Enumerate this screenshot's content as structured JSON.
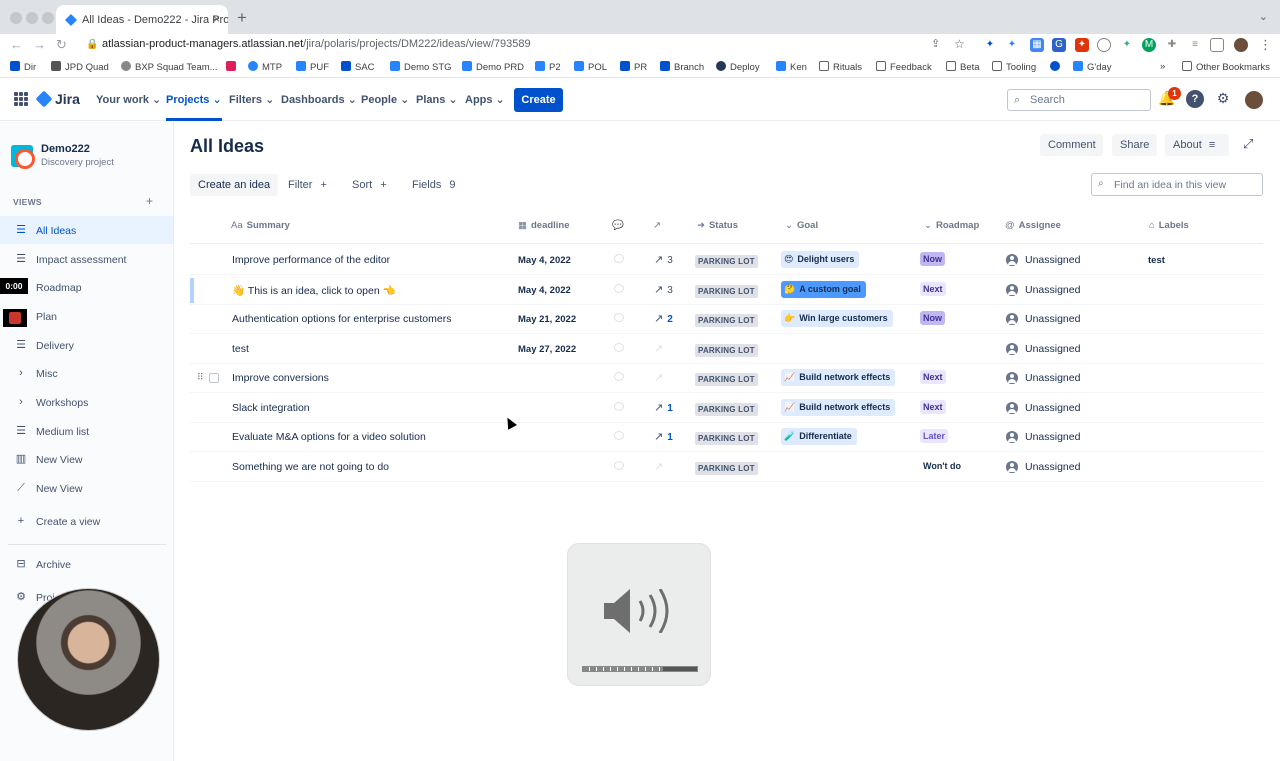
{
  "browser": {
    "tab_title": "All Ideas - Demo222 - Jira Pro…",
    "tab_close": "×",
    "new_tab": "+",
    "url_host": "atlassian-product-managers.atlassian.net",
    "url_path": "/jira/polaris/projects/DM222/ideas/view/793589",
    "bookmarks": [
      "Dir",
      "JPD Quad",
      "BXP Squad Team...",
      "MTP",
      "PUF",
      "SAC",
      "Demo STG",
      "Demo PRD",
      "P2",
      "POL",
      "PR",
      "Branch",
      "Deploy",
      "Ken",
      "Rituals",
      "Feedback",
      "Beta",
      "Tooling",
      "G'day"
    ],
    "bookmarks_overflow": "»",
    "other_bookmarks": "Other Bookmarks"
  },
  "topnav": {
    "logo": "Jira",
    "items": [
      "Your work",
      "Projects",
      "Filters",
      "Dashboards",
      "People",
      "Plans",
      "Apps"
    ],
    "create": "Create",
    "search_placeholder": "Search",
    "notification_count": "1"
  },
  "sidebar": {
    "project_name": "Demo222",
    "project_type": "Discovery project",
    "views_label": "VIEWS",
    "items": [
      "All Ideas",
      "Impact assessment",
      "Roadmap",
      "Plan",
      "Delivery",
      "Misc",
      "Workshops",
      "Medium list",
      "New View",
      "New View",
      "Create a view",
      "Archive",
      "Proj…"
    ],
    "timer": "0:00"
  },
  "main": {
    "title": "All Ideas",
    "header_buttons": [
      "Comment",
      "Share",
      "About"
    ],
    "toolbar": {
      "create": "Create an idea",
      "filter": "Filter",
      "sort": "Sort",
      "fields": "Fields",
      "fields_count": "9",
      "find_placeholder": "Find an idea in this view"
    },
    "columns": [
      "Summary",
      "deadline",
      "Status",
      "Goal",
      "Roadmap",
      "Assignee",
      "Labels"
    ],
    "rows": [
      {
        "summary": "Improve performance of the editor",
        "deadline": "May 4, 2022",
        "trend": "3",
        "status": "PARKING LOT",
        "goal_emoji": "😍",
        "goal": "Delight users",
        "roadmap": "Now",
        "assignee": "Unassigned",
        "labels": "test"
      },
      {
        "summary": "👋 This is an idea, click to open 👈",
        "deadline": "May 4, 2022",
        "trend": "3",
        "status": "PARKING LOT",
        "goal_emoji": "🤔",
        "goal": "A custom goal",
        "roadmap": "Next",
        "assignee": "Unassigned",
        "labels": ""
      },
      {
        "summary": "Authentication options for enterprise customers",
        "deadline": "May 21, 2022",
        "trend": "2",
        "status": "PARKING LOT",
        "goal_emoji": "👉",
        "goal": "Win large customers",
        "roadmap": "Now",
        "assignee": "Unassigned",
        "labels": ""
      },
      {
        "summary": "test",
        "deadline": "May 27, 2022",
        "trend": "",
        "status": "PARKING LOT",
        "goal_emoji": "",
        "goal": "",
        "roadmap": "",
        "assignee": "Unassigned",
        "labels": ""
      },
      {
        "summary": "Improve conversions",
        "deadline": "",
        "trend": "",
        "status": "PARKING LOT",
        "goal_emoji": "📈",
        "goal": "Build network effects",
        "roadmap": "Next",
        "assignee": "Unassigned",
        "labels": ""
      },
      {
        "summary": "Slack integration",
        "deadline": "",
        "trend": "1",
        "status": "PARKING LOT",
        "goal_emoji": "📈",
        "goal": "Build network effects",
        "roadmap": "Next",
        "assignee": "Unassigned",
        "labels": ""
      },
      {
        "summary": "Evaluate M&A options for a video solution",
        "deadline": "",
        "trend": "1",
        "status": "PARKING LOT",
        "goal_emoji": "🧪",
        "goal": "Differentiate",
        "roadmap": "Later",
        "assignee": "Unassigned",
        "labels": ""
      },
      {
        "summary": "Something we are not going to do",
        "deadline": "",
        "trend": "",
        "status": "PARKING LOT",
        "goal_emoji": "",
        "goal": "",
        "roadmap": "Won't do",
        "assignee": "Unassigned",
        "labels": ""
      }
    ]
  },
  "volume_hud": {
    "level": 0.7
  },
  "colors": {
    "brand": "#0052CC",
    "goal_bg": "#DEEBFF",
    "goal_selected_bg": "#4C9AFF"
  }
}
